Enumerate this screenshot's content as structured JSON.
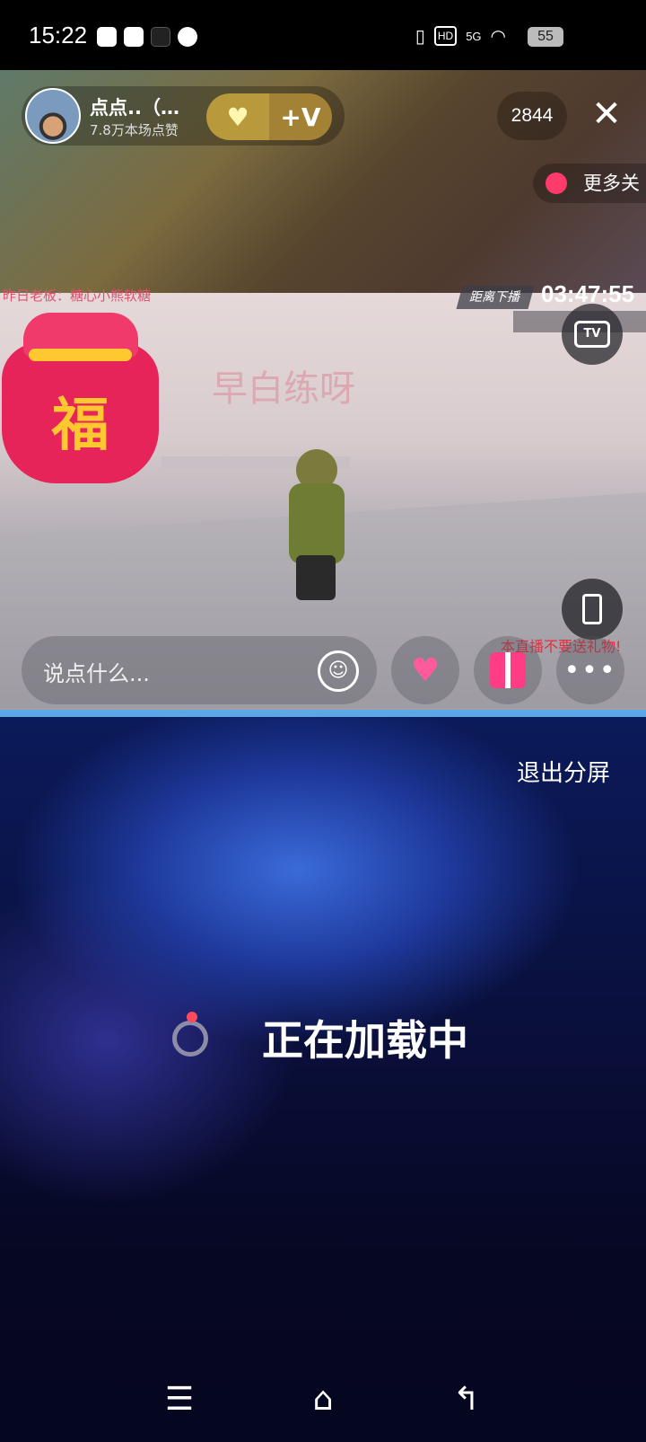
{
  "status_bar": {
    "time": "15:22",
    "hd_label": "HD",
    "network_label": "5G",
    "battery": "55"
  },
  "live": {
    "host_name": "点点..（…",
    "likes_text": "7.8万本场点赞",
    "follow_label": "+V",
    "viewer_count": "2844",
    "more_live_label": "更多关",
    "notice_text": "昨日老板：糖心小熊软糖",
    "countdown_label": "距离下播",
    "countdown": "03:47:55",
    "scene_text": "早白练呀",
    "bag_char": "福",
    "ticker_text": "本直播不要送礼物!",
    "comment_placeholder": "说点什么...",
    "more_label": "•••",
    "tv_label": "TV"
  },
  "split": {
    "exit_label": "退出分屏",
    "loading_text": "正在加载中"
  },
  "nav": {
    "menu_glyph": "☰",
    "home_glyph": "⌂",
    "back_glyph": "↰"
  },
  "colors": {
    "accent_red": "#ff4a5e",
    "divider_blue": "#5da7e6",
    "gold": "#b89a3c"
  }
}
